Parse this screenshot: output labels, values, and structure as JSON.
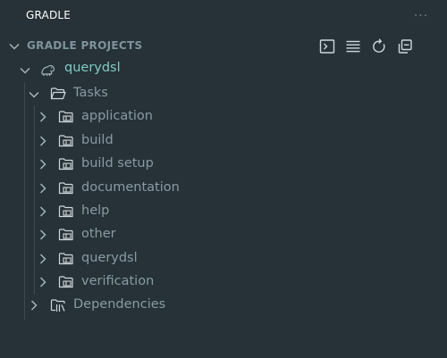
{
  "panel": {
    "title": "GRADLE",
    "more_label": "···"
  },
  "section": {
    "title": "GRADLE PROJECTS",
    "toolbar_icons": [
      "terminal-icon",
      "list-icon",
      "refresh-icon",
      "collapse-all-icon"
    ]
  },
  "colors": {
    "background": "#263238",
    "project_label": "#80cbc4",
    "task_label": "#8a9ba3",
    "header_text": "#ffffff"
  },
  "tree": {
    "project": {
      "label": "querydsl",
      "icon": "elephant-icon",
      "expanded": true
    },
    "tasks_folder": {
      "label": "Tasks",
      "expanded": true
    },
    "task_groups": [
      {
        "label": "application"
      },
      {
        "label": "build"
      },
      {
        "label": "build setup"
      },
      {
        "label": "documentation"
      },
      {
        "label": "help"
      },
      {
        "label": "other"
      },
      {
        "label": "querydsl"
      },
      {
        "label": "verification"
      }
    ],
    "dependencies": {
      "label": "Dependencies",
      "expanded": false
    }
  }
}
